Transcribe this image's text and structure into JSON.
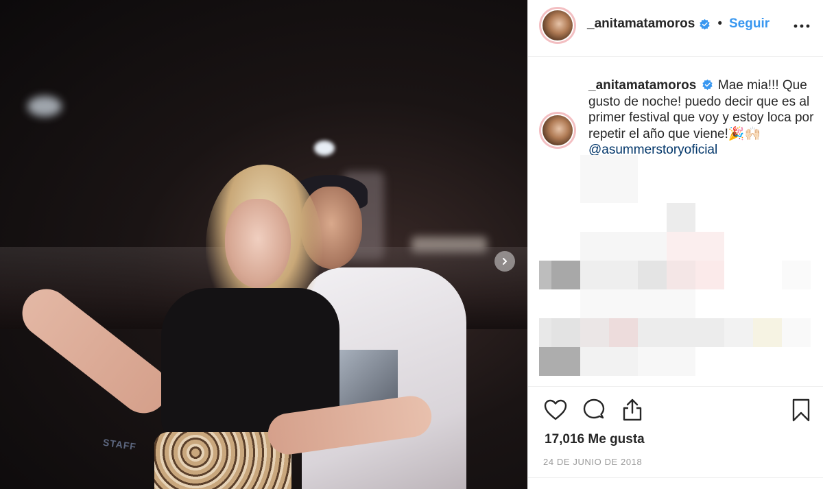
{
  "post": {
    "username": "_anitamatamoros",
    "verified": true,
    "follow_label": "Seguir",
    "separator": "•",
    "caption_text": "Mae mia!!! Que gusto de noche! puedo decir que es al primer festival que voy y estoy loca por repetir el año que viene!🎉🙌🏻",
    "caption_mention": "@asummerstoryoficial",
    "likes_text": "17,016 Me gusta",
    "date_text": "24 DE JUNIO DE 2018"
  },
  "photo": {
    "overlay_text": "STAFF"
  },
  "icons": {
    "verified": "verified-badge-icon",
    "more": "more-options-icon",
    "like": "heart-icon",
    "comment": "comment-icon",
    "share": "share-icon",
    "save": "bookmark-icon",
    "next": "chevron-right-icon"
  },
  "colors": {
    "link_blue": "#3897f0",
    "mention_blue": "#003569",
    "avatar_ring": "#f3bfc2",
    "muted": "#999999"
  }
}
